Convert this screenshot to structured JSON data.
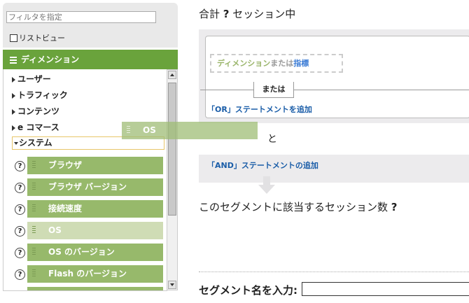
{
  "filter": {
    "placeholder": "フィルタを指定"
  },
  "listview_label": "リストビュー",
  "dimensions_header": "ディメンション",
  "categories": [
    "ユーザー",
    "トラフィック",
    "コンテンツ",
    "e コマース",
    "システム"
  ],
  "help_glyph": "?",
  "system_items": [
    {
      "label": "ブラウザ"
    },
    {
      "label": "ブラウザ バージョン"
    },
    {
      "label": "接続速度"
    },
    {
      "label": "OS",
      "state": "dragging"
    },
    {
      "label": "OS のバージョン"
    },
    {
      "label": "Flash のバージョン"
    }
  ],
  "drag_ghost_label": "OS",
  "summary": {
    "prefix": "合計",
    "value": "?",
    "suffix": "セッション中"
  },
  "builder": {
    "drop_hint_dim": "ディメンション",
    "drop_hint_or": "または",
    "drop_hint_metric": "指標",
    "or_label": "または",
    "or_statement": "「OR」ステートメントを追加",
    "and_label": "と",
    "and_statement": "「AND」ステートメントの追加"
  },
  "question": {
    "text": "このセグメントに該当するセッション数",
    "value": "?"
  },
  "segment_name": {
    "label": "セグメント名を入力:",
    "value": ""
  },
  "colors": {
    "green": "#6aa33c",
    "item_green": "#97b96b",
    "link_blue": "#1a5da8",
    "panel_gray": "#ecebed"
  },
  "icons": [
    "menu-icon",
    "expand-icon",
    "collapse-icon",
    "help-icon",
    "drag-handle-icon",
    "down-arrow-icon",
    "scroll-up-icon",
    "scroll-down-icon"
  ]
}
